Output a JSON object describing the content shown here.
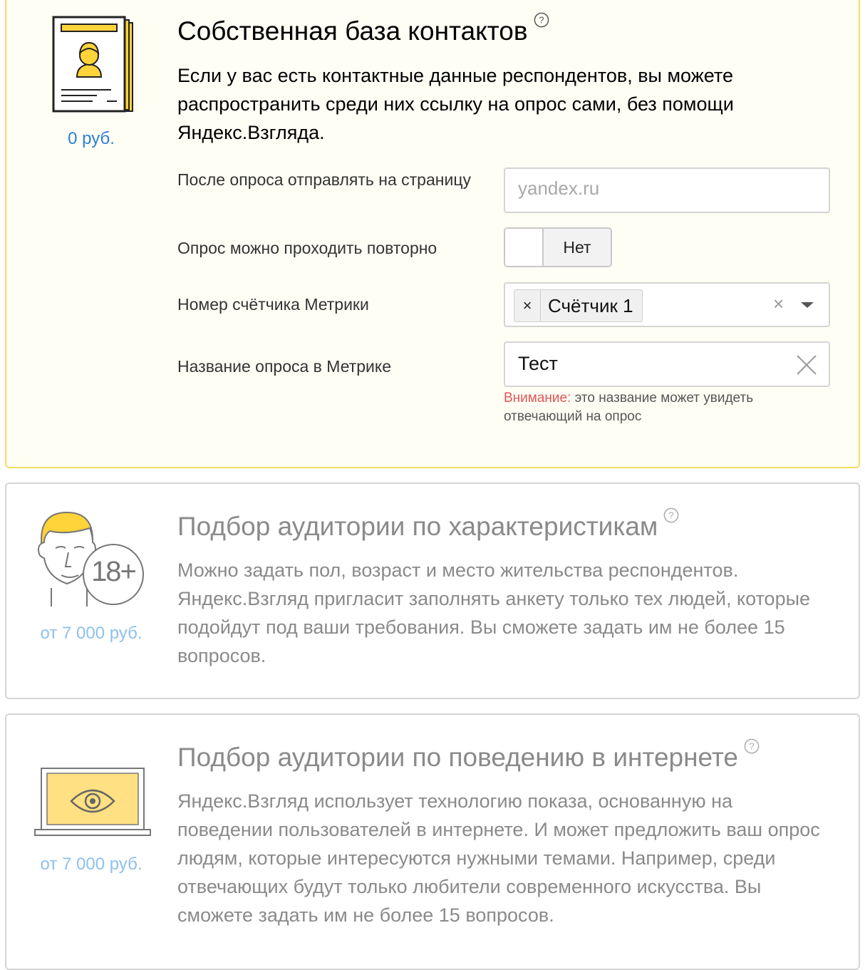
{
  "cards": [
    {
      "title": "Собственная база контактов",
      "description": "Если у вас есть контактные данные респондентов, вы можете распространить среди них ссылку на опрос сами, без помощи Яндекс.Взгляда.",
      "price": "0 руб.",
      "icon": "contact-list-document-icon",
      "active": true,
      "form": {
        "redirect": {
          "label": "После опроса отправлять на страницу",
          "placeholder": "yandex.ru"
        },
        "repeat": {
          "label": "Опрос можно проходить повторно",
          "toggle_text": "Нет"
        },
        "counter": {
          "label": "Номер счётчика Метрики",
          "tag_remove": "×",
          "tag": "Счётчик 1",
          "clear": "×"
        },
        "metrika_name": {
          "label": "Название опроса в Метрике",
          "value": "Тест"
        },
        "warning_prefix": "Внимание:",
        "warning_text": " это название может увидеть отвечающий на опрос"
      }
    },
    {
      "title": "Подбор аудитории по характеристикам",
      "description": "Можно задать пол, возраст и место жительства респондентов. Яндекс.Взгляд пригласит заполнять анкету только тех людей, которые подойдут под ваши требования. Вы сможете задать им не более 15 вопросов.",
      "price": "от 7 000 руб.",
      "icon": "person-age-18-icon",
      "icon_text": "18+",
      "active": false
    },
    {
      "title": "Подбор аудитории по поведению в интернете",
      "description": "Яндекс.Взгляд использует технологию показа, основанную на поведении пользователей в интернете. И может предложить ваш опрос людям, которые интересуются нужными темами. Например, среди отвечающих будут только любители современного искусства. Вы сможете задать им не более 15 вопросов.",
      "price": "от 7 000 руб.",
      "icon": "laptop-eye-icon",
      "active": false
    }
  ],
  "help_icon": "question-circle-icon",
  "colors": {
    "active_border": "#f2dc6a",
    "accent_yellow": "#ffd33a",
    "price_link": "#2f7fd8",
    "price_muted": "#8fc0ee",
    "warning": "#e25555"
  }
}
